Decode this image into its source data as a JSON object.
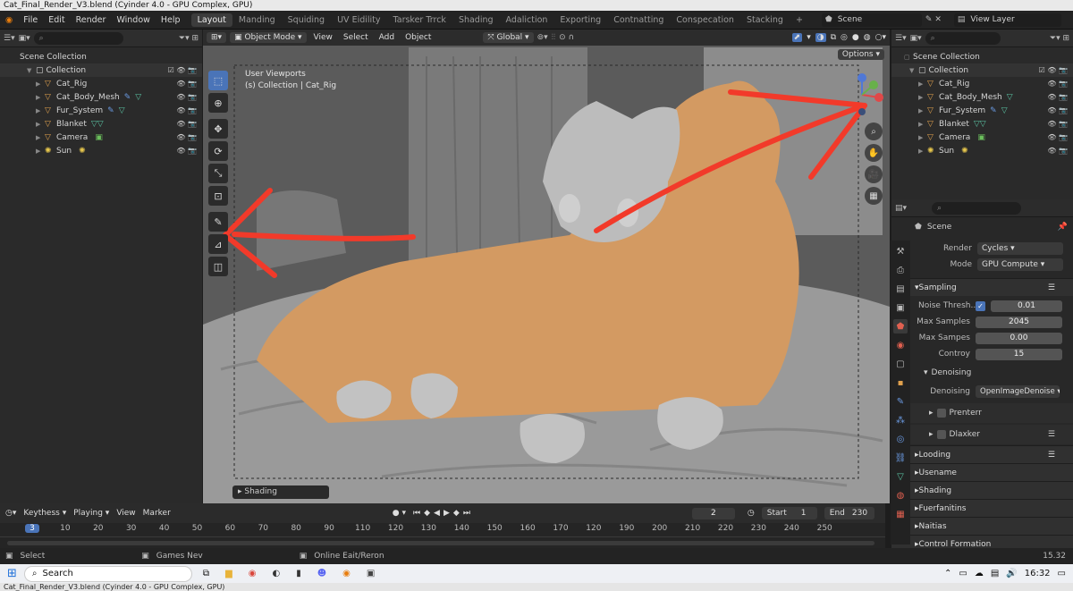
{
  "window_title": "Cat_Final_Render_V3.blend (Cyinder 4.0 - GPU Complex, GPU)",
  "menu": [
    "File",
    "Edit",
    "Render",
    "Window",
    "Help"
  ],
  "workspaces": [
    "Layout",
    "Manding",
    "Squiding",
    "UV Eidility",
    "Tarsker Trrck",
    "Shading",
    "Adaliction",
    "Exporting",
    "Contnatting",
    "Conspecation",
    "Stacking"
  ],
  "scene_name": "Scene",
  "view_layer": "View Layer",
  "outliner": {
    "scene_collection": "Scene Collection",
    "collection": "Collection",
    "items": [
      "Cat_Rig",
      "Cat_Body_Mesh",
      "Fur_System",
      "Blanket",
      "Camera",
      "Sun"
    ]
  },
  "viewport": {
    "mode": "Object Mode",
    "menus": [
      "View",
      "Select",
      "Add",
      "Object"
    ],
    "transform": "Global",
    "options": "Options",
    "overlay_title": "User Viewports",
    "overlay_sub": "(s) Collection | Cat_Rig",
    "shading_panel": "Shading"
  },
  "properties": {
    "context": "Scene",
    "render_label": "Render",
    "render_value": "Cycles",
    "mode_label": "Mode",
    "mode_value": "GPU Compute",
    "sampling": "Sampling",
    "noise_label": "Noise Thresh...",
    "noise_value": "0.01",
    "max_samples_label": "Max Samples",
    "max_samples_value": "2045",
    "max_samps_label": "Max Sampes",
    "max_samps_value": "0.00",
    "controy_label": "Controy",
    "controy_value": "15",
    "denoising": "Denoising",
    "denoising_label": "Denoising",
    "denoising_value": "OpenImageDenoise",
    "sub1": "Prenterr",
    "sub2": "Dlaxker",
    "sections": [
      "Looding",
      "Usename",
      "Shading",
      "Fuerfanitins",
      "Naitias",
      "Control Formation"
    ]
  },
  "timeline": {
    "menus": [
      "Keythess",
      "Playing",
      "View",
      "Marker"
    ],
    "current_frame": "2",
    "start_label": "Start",
    "start": "1",
    "end_label": "End",
    "end": "230",
    "ticks": [
      "3",
      "10",
      "20",
      "30",
      "40",
      "50",
      "60",
      "70",
      "80",
      "90",
      "110",
      "120",
      "130",
      "140",
      "150",
      "160",
      "170",
      "120",
      "190",
      "200",
      "210",
      "220",
      "230",
      "240",
      "250"
    ],
    "status_select": "Select",
    "status_games": "Games Nev",
    "status_online": "Online Eait/Reron",
    "status_version": "15.32"
  },
  "taskbar": {
    "search": "Search",
    "time": "16:32"
  },
  "bottom_title": "Cat_Final_Render_V3.blend (Cyinder 4.0 - GPU Complex, GPU)",
  "colors": {
    "accent": "#4a74b8",
    "arrow": "#f23a2a",
    "fur": "#d39a62"
  }
}
